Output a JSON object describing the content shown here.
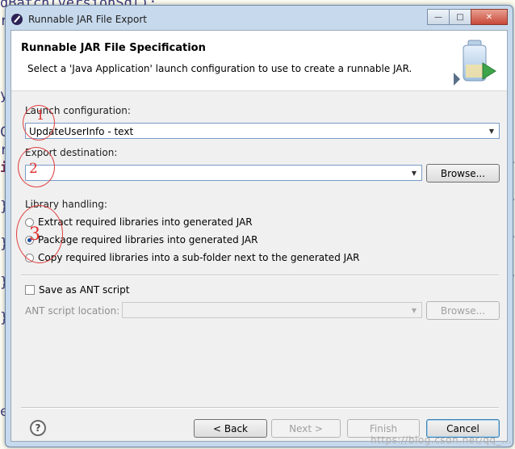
{
  "background_editor": {
    "lines": [
      {
        "text": "dBatch(versionSql);",
        "color": "#3a3a7a"
      },
      {
        "text": "r",
        "color": "#3a3a7a"
      },
      {
        "text": "y",
        "color": "#3a3a7a"
      },
      {
        "text": "C",
        "color": "#3a3a7a"
      },
      {
        "text": "r",
        "color": "#3a3a7a"
      },
      {
        "text": "i",
        "color": "#7a2a55"
      },
      {
        "text": "}",
        "color": "#3a3a7a"
      },
      {
        "text": "}",
        "color": "#3a3a7a"
      },
      {
        "text": "}",
        "color": "#3a3a7a"
      },
      {
        "text": "}",
        "color": "#3a3a7a"
      },
      {
        "text": "e",
        "color": "#3a3a7a"
      }
    ],
    "right_chars": [
      ")",
      "/",
      "/",
      "/",
      "/"
    ]
  },
  "window": {
    "title": "Runnable JAR File Export",
    "minimize_glyph": "—",
    "maximize_glyph": "□",
    "close_glyph": "✕"
  },
  "banner": {
    "title": "Runnable JAR File Specification",
    "description": "Select a 'Java Application' launch configuration to use to create a runnable JAR."
  },
  "launch": {
    "label": "Launch configuration:",
    "value": "UpdateUserInfo - text"
  },
  "export": {
    "label": "Export destination:",
    "value": "",
    "browse_label": "Browse..."
  },
  "library": {
    "label": "Library handling:",
    "options": [
      {
        "label": "Extract required libraries into generated JAR",
        "checked": false
      },
      {
        "label": "Package required libraries into generated JAR",
        "checked": true
      },
      {
        "label": "Copy required libraries into a sub-folder next to the generated JAR",
        "checked": false
      }
    ]
  },
  "ant": {
    "save_label": "Save as ANT script",
    "checked": false,
    "location_label": "ANT script location:",
    "location_value": "",
    "browse_label": "Browse..."
  },
  "footer": {
    "help_glyph": "?",
    "back_label": "< Back",
    "next_label": "Next >",
    "finish_label": "Finish",
    "cancel_label": "Cancel"
  },
  "annotations": [
    "1",
    "2",
    "3"
  ],
  "watermark": "https://blog.csdn.net/qq_..."
}
